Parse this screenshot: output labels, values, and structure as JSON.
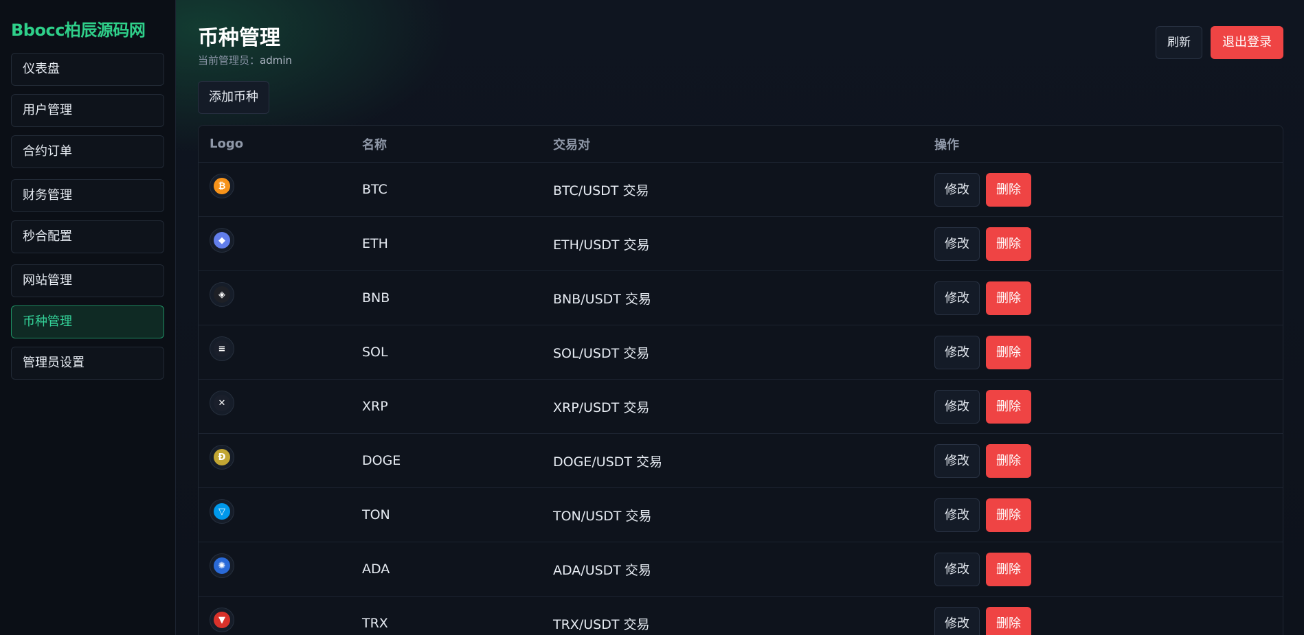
{
  "brand": "Bbocc柏辰源码网",
  "sidebar": {
    "groups": [
      [
        "仪表盘",
        "用户管理",
        "合约订单"
      ],
      [
        "财务管理",
        "秒合配置"
      ],
      [
        "网站管理",
        "币种管理",
        "管理员设置"
      ]
    ],
    "active": "币种管理"
  },
  "header": {
    "title": "币种管理",
    "admin_prefix": "当前管理员：",
    "admin_name": "admin",
    "refresh_label": "刷新",
    "logout_label": "退出登录"
  },
  "add_button_label": "添加币种",
  "table": {
    "columns": [
      "Logo",
      "名称",
      "交易对",
      "操作"
    ],
    "edit_label": "修改",
    "delete_label": "删除",
    "rows": [
      {
        "name": "BTC",
        "pair": "BTC/USDT 交易",
        "icon": "bitcoin-icon",
        "color": "#f7931a",
        "glyph": "₿"
      },
      {
        "name": "ETH",
        "pair": "ETH/USDT 交易",
        "icon": "ethereum-icon",
        "color": "#627eea",
        "glyph": "◆"
      },
      {
        "name": "BNB",
        "pair": "BNB/USDT 交易",
        "icon": "bnb-icon",
        "color": "#1e2026",
        "glyph": "◈"
      },
      {
        "name": "SOL",
        "pair": "SOL/USDT 交易",
        "icon": "solana-icon",
        "color": "#1a1f2b",
        "glyph": "≡"
      },
      {
        "name": "XRP",
        "pair": "XRP/USDT 交易",
        "icon": "xrp-icon",
        "color": "#1a1f2b",
        "glyph": "✕"
      },
      {
        "name": "DOGE",
        "pair": "DOGE/USDT 交易",
        "icon": "doge-icon",
        "color": "#c2a633",
        "glyph": "Ð"
      },
      {
        "name": "TON",
        "pair": "TON/USDT 交易",
        "icon": "ton-icon",
        "color": "#0098ea",
        "glyph": "▽"
      },
      {
        "name": "ADA",
        "pair": "ADA/USDT 交易",
        "icon": "cardano-icon",
        "color": "#2a6ad8",
        "glyph": "✺"
      },
      {
        "name": "TRX",
        "pair": "TRX/USDT 交易",
        "icon": "tron-icon",
        "color": "#d9322b",
        "glyph": "▼"
      }
    ]
  }
}
